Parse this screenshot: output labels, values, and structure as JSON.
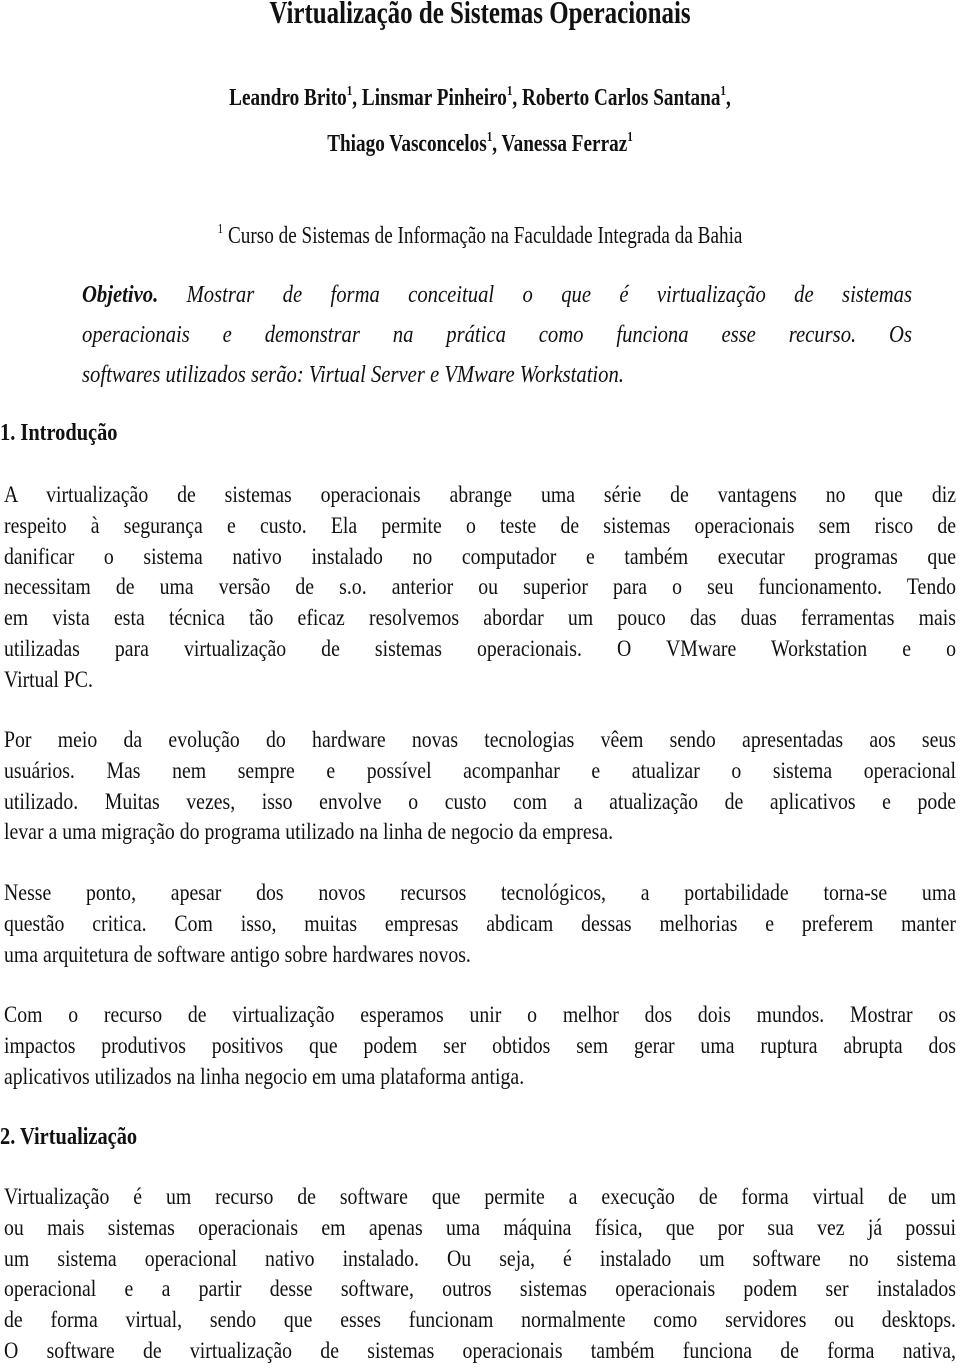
{
  "document": {
    "title": "Virtualização de Sistemas Operacionais",
    "authors_line1": [
      {
        "name": "Leandro Brito",
        "sup": "1",
        "sep": ", "
      },
      {
        "name": "Linsmar Pinheiro",
        "sup": "1",
        "sep": ", "
      },
      {
        "name": "Roberto Carlos Santana",
        "sup": "1",
        "sep": ","
      }
    ],
    "authors_line2": [
      {
        "name": "Thiago Vasconcelos",
        "sup": "1",
        "sep": ", "
      },
      {
        "name": "Vanessa Ferraz",
        "sup": "1",
        "sep": ""
      }
    ],
    "affiliation": {
      "sup": "1",
      "text": " Curso de Sistemas de Informação na Faculdade Integrada da Bahia"
    },
    "objective": {
      "label": "Objetivo.",
      "lines": [
        " Mostrar de forma conceitual o que é virtualização de sistemas",
        "operacionais e demonstrar na prática como funciona esse recurso. Os",
        "softwares utilizados serão: Virtual Server e VMware Workstation."
      ]
    },
    "sections": [
      {
        "heading": "1. Introdução",
        "paragraphs": [
          [
            "A virtualização de sistemas operacionais abrange uma série de vantagens no que diz",
            "respeito à segurança e custo. Ela permite o teste de sistemas operacionais sem risco de",
            "danificar o sistema nativo instalado no computador e também executar programas que",
            "necessitam de uma versão de s.o. anterior ou superior para o seu funcionamento. Tendo",
            "em vista esta técnica tão eficaz resolvemos abordar um pouco das duas ferramentas mais",
            "utilizadas para virtualização de sistemas operacionais. O VMware Workstation e o",
            "Virtual PC."
          ],
          [
            "Por meio da evolução do hardware novas tecnologias vêem sendo apresentadas aos seus",
            "usuários. Mas nem sempre e possível acompanhar e atualizar o sistema operacional",
            "utilizado. Muitas vezes, isso envolve o custo com a atualização de aplicativos e pode",
            "levar a uma migração do programa utilizado na linha de negocio da empresa."
          ],
          [
            "Nesse ponto, apesar dos novos recursos tecnológicos, a portabilidade torna-se uma",
            "questão critica. Com isso, muitas empresas abdicam dessas melhorias e preferem manter",
            "uma arquitetura de software antigo sobre hardwares novos."
          ],
          [
            "Com o recurso de virtualização esperamos unir o melhor dos dois mundos. Mostrar os",
            "impactos produtivos positivos que podem ser obtidos sem gerar uma ruptura abrupta dos",
            "aplicativos utilizados na linha negocio em uma plataforma antiga."
          ]
        ]
      },
      {
        "heading": "2. Virtualização",
        "paragraphs": [
          [
            "Virtualização é um recurso de software que permite a execução de forma virtual de um",
            "ou mais sistemas operacionais em apenas uma máquina física, que por sua vez já possui",
            "um sistema operacional nativo instalado. Ou seja, é instalado um software no sistema",
            "operacional e a partir desse software, outros sistemas operacionais podem ser instalados",
            "de forma virtual, sendo que esses funcionam normalmente como servidores ou desktops.",
            "O software de virtualização de sistemas operacionais também funciona de forma nativa,"
          ]
        ]
      }
    ]
  }
}
